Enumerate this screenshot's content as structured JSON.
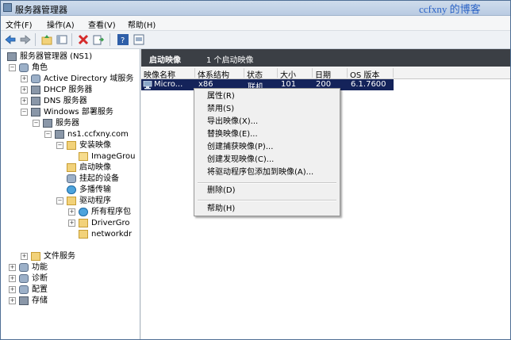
{
  "window": {
    "title": "服务器管理器",
    "watermark": "ccfxny 的博客"
  },
  "menubar": [
    "文件(F)",
    "操作(A)",
    "查看(V)",
    "帮助(H)"
  ],
  "tree": [
    {
      "label": "服务器管理器 (NS1)",
      "level": 0,
      "expander": "",
      "icon": "server-manager-icon"
    },
    {
      "label": "角色",
      "level": 1,
      "expander": "−",
      "icon": "roles-icon"
    },
    {
      "label": "Active Directory 域服务",
      "level": 2,
      "expander": "+",
      "icon": "ad-icon"
    },
    {
      "label": "DHCP 服务器",
      "level": 2,
      "expander": "+",
      "icon": "dhcp-icon"
    },
    {
      "label": "DNS 服务器",
      "level": 2,
      "expander": "+",
      "icon": "dns-icon"
    },
    {
      "label": "Windows 部署服务",
      "level": 2,
      "expander": "−",
      "icon": "wds-icon"
    },
    {
      "label": "服务器",
      "level": 3,
      "expander": "−",
      "icon": "servers-icon"
    },
    {
      "label": "ns1.ccfxny.com",
      "level": 4,
      "expander": "−",
      "icon": "server-icon"
    },
    {
      "label": "安装映像",
      "level": 5,
      "expander": "−",
      "icon": "folder-icon"
    },
    {
      "label": "ImageGrou",
      "level": 6,
      "expander": "",
      "icon": "image-group-icon"
    },
    {
      "label": "启动映像",
      "level": 5,
      "expander": "",
      "icon": "folder-icon"
    },
    {
      "label": "挂起的设备",
      "level": 5,
      "expander": "",
      "icon": "pending-devices-icon"
    },
    {
      "label": "多播传输",
      "level": 5,
      "expander": "",
      "icon": "multicast-icon"
    },
    {
      "label": "驱动程序",
      "level": 5,
      "expander": "−",
      "icon": "folder-icon"
    },
    {
      "label": "所有程序包",
      "level": 6,
      "expander": "+",
      "icon": "packages-icon"
    },
    {
      "label": "DriverGro",
      "level": 6,
      "expander": "+",
      "icon": "driver-group-icon"
    },
    {
      "label": "networkdr",
      "level": 6,
      "expander": "",
      "icon": "network-driver-icon"
    },
    {
      "label": "",
      "level": 0,
      "expander": "",
      "icon": ""
    },
    {
      "label": "文件服务",
      "level": 2,
      "expander": "+",
      "icon": "file-services-icon"
    },
    {
      "label": "功能",
      "level": 1,
      "expander": "+",
      "icon": "features-icon"
    },
    {
      "label": "诊断",
      "level": 1,
      "expander": "+",
      "icon": "diagnostics-icon"
    },
    {
      "label": "配置",
      "level": 1,
      "expander": "+",
      "icon": "configuration-icon"
    },
    {
      "label": "存储",
      "level": 1,
      "expander": "+",
      "icon": "storage-icon"
    }
  ],
  "pane": {
    "title": "启动映像",
    "count": "1 个启动映像",
    "columns": [
      "映像名称",
      "体系结构",
      "状态",
      "大小",
      "日期",
      "OS 版本"
    ],
    "rows": [
      [
        "Micro...",
        "x86",
        "联机",
        "101",
        "200",
        "6.1.7600"
      ]
    ]
  },
  "context_menu": {
    "groups": [
      [
        "属性(R)",
        "禁用(S)",
        "导出映像(X)...",
        "替换映像(E)...",
        "创建捕获映像(P)...",
        "创建发现映像(C)...",
        "将驱动程序包添加到映像(A)..."
      ],
      [
        "删除(D)"
      ],
      [
        "帮助(H)"
      ]
    ]
  },
  "colors": {
    "header_bg": "#3b3f45",
    "selected_row": "#14235a",
    "accent": "#2b63c6"
  }
}
